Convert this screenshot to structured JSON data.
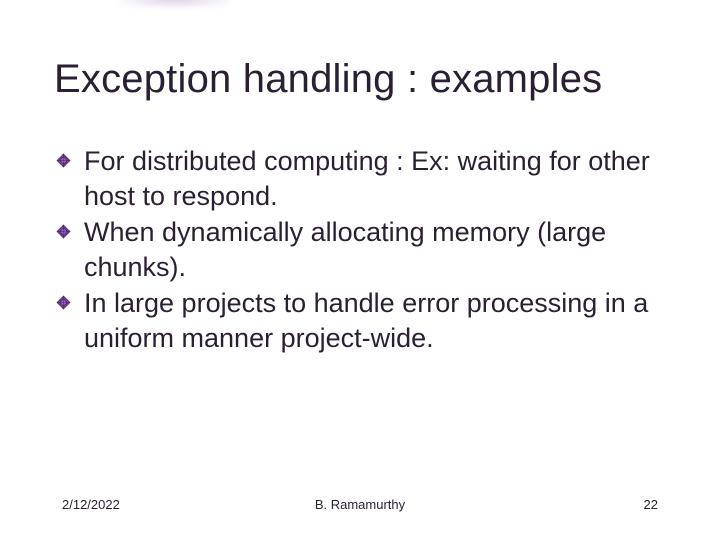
{
  "title": "Exception handling : examples",
  "bullets": [
    "For distributed computing : Ex: waiting for other host to respond.",
    "When dynamically allocating memory (large chunks).",
    "In large projects to handle error processing in a uniform manner project-wide."
  ],
  "footer": {
    "date": "2/12/2022",
    "author": "B. Ramamurthy",
    "page": "22"
  },
  "colors": {
    "bullet_fill": "#7a3fa0",
    "bullet_stroke": "#3d1f55"
  }
}
